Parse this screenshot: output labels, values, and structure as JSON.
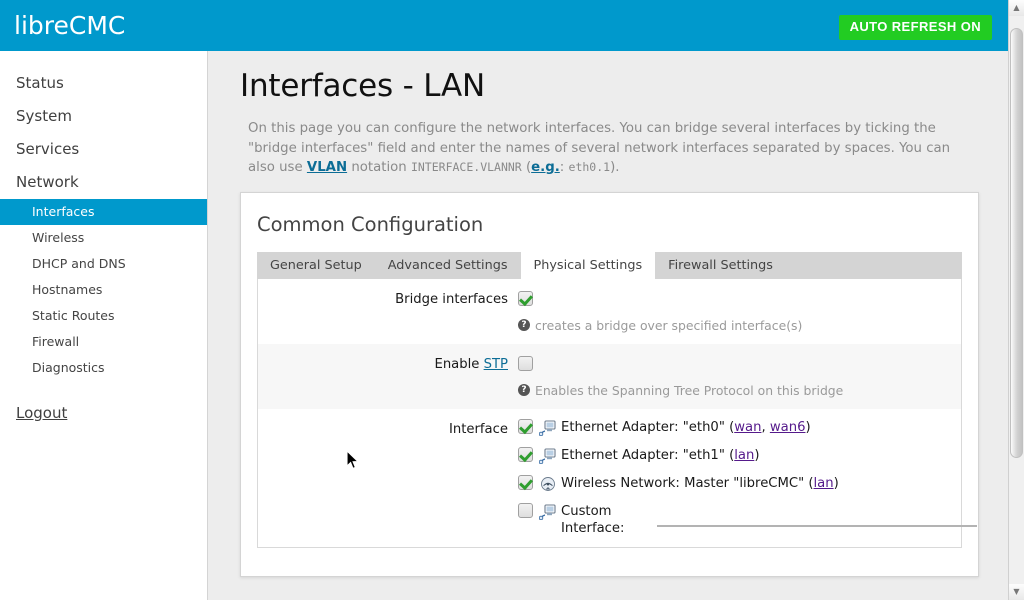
{
  "header": {
    "brand": "libreCMC",
    "auto_refresh_label": "AUTO REFRESH ON",
    "brand_bg": "#0099cc",
    "refresh_bg": "#22cc22"
  },
  "sidebar": {
    "top_items": [
      {
        "label": "Status"
      },
      {
        "label": "System"
      },
      {
        "label": "Services"
      },
      {
        "label": "Network"
      }
    ],
    "sub_items": [
      {
        "label": "Interfaces",
        "active": true
      },
      {
        "label": "Wireless",
        "active": false
      },
      {
        "label": "DHCP and DNS",
        "active": false
      },
      {
        "label": "Hostnames",
        "active": false
      },
      {
        "label": "Static Routes",
        "active": false
      },
      {
        "label": "Firewall",
        "active": false
      },
      {
        "label": "Diagnostics",
        "active": false
      }
    ],
    "logout_label": "Logout",
    "active_bg": "#0099cc"
  },
  "main": {
    "page_title": "Interfaces - LAN",
    "description": {
      "part1": "On this page you can configure the network interfaces. You can bridge several interfaces by ticking the \"bridge interfaces\" field and enter the names of several network interfaces separated by spaces. You can also use ",
      "link_vlan": "VLAN",
      "part2": " notation ",
      "mono_notation": "INTERFACE.VLANNR",
      "part3": " (",
      "link_eg": "e.g.",
      "part4": ": ",
      "mono_example": "eth0.1",
      "part5": ")."
    },
    "panel_title": "Common Configuration",
    "tabs": [
      {
        "label": "General Setup",
        "active": false
      },
      {
        "label": "Advanced Settings",
        "active": false
      },
      {
        "label": "Physical Settings",
        "active": true
      },
      {
        "label": "Firewall Settings",
        "active": false
      }
    ],
    "rows": {
      "bridge": {
        "label": "Bridge interfaces",
        "checked": true,
        "hint": "creates a bridge over specified interface(s)",
        "hint_icon": "help-circle-icon"
      },
      "stp": {
        "label_prefix": "Enable ",
        "label_link": "STP",
        "checked": false,
        "hint": "Enables the Spanning Tree Protocol on this bridge",
        "hint_icon": "help-circle-icon"
      },
      "interface": {
        "label": "Interface",
        "items": [
          {
            "checked": true,
            "icon": "ethernet-adapter-icon",
            "text_before": "Ethernet Adapter: \"eth0\" (",
            "links": [
              "wan",
              "wan6"
            ],
            "separator": ", ",
            "text_after": ")"
          },
          {
            "checked": true,
            "icon": "ethernet-adapter-icon",
            "text_before": "Ethernet Adapter: \"eth1\" (",
            "links": [
              "lan"
            ],
            "separator": ", ",
            "text_after": ")"
          },
          {
            "checked": true,
            "icon": "wireless-network-icon",
            "text_before": "Wireless Network: Master \"libreCMC\" (",
            "links": [
              "lan"
            ],
            "separator": ", ",
            "text_after": ")"
          }
        ],
        "custom": {
          "checked": false,
          "icon": "ethernet-adapter-icon",
          "label": "Custom Interface:",
          "value": "",
          "placeholder": ""
        }
      }
    }
  },
  "scrollbar": {
    "up_arrow": "▲",
    "down_arrow": "▼"
  }
}
